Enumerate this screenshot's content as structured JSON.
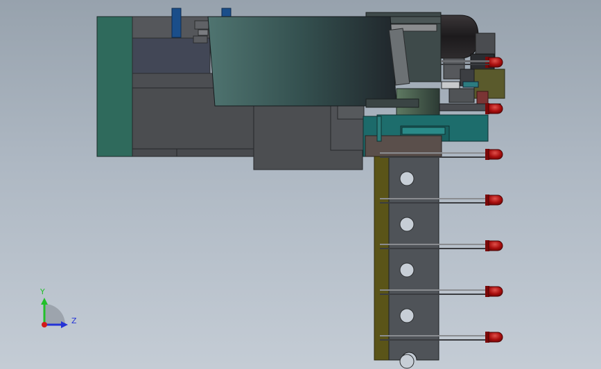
{
  "viewport": {
    "background_colors": [
      "#97a2ad",
      "#c4ccd5"
    ]
  },
  "triad": {
    "y_label": "Y",
    "z_label": "Z",
    "y_color": "#22c02a",
    "z_color": "#2433d6",
    "origin_color": "#d21a1a"
  },
  "model": {
    "view": "side",
    "parts": [
      "left-plate",
      "main-body",
      "cover-plate",
      "cylinder-cap",
      "mold-block",
      "vertical-strip",
      "pin-holder",
      "led-array"
    ],
    "hole_count": 5,
    "led_count": 7,
    "colors": {
      "left_plate": "#2f6a5c",
      "body": "#4a4d52",
      "cover": "#3a5552",
      "teal_block": "#1d6d6c",
      "strip": "#5a5418",
      "holder": "#4f5358",
      "led": "#a80e0e",
      "cap": "#1d1b1d",
      "rod": "#1a4e8a"
    }
  }
}
